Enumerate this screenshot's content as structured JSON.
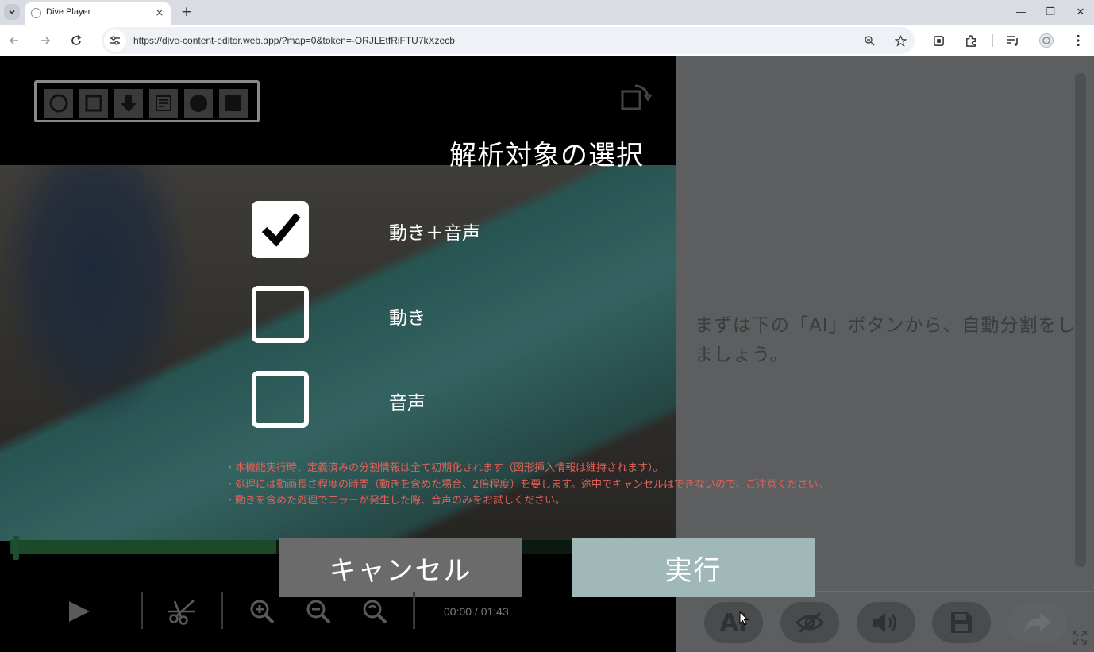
{
  "browser": {
    "tab_title": "Dive Player",
    "tab_close": "×",
    "new_tab": "+",
    "url": "https://dive-content-editor.web.app/?map=0&token=-ORJLEtfRiFTU7kXzecb",
    "window_controls": {
      "minimize": "—",
      "restore": "❐",
      "close": "✕"
    }
  },
  "editor": {
    "shape_tools": [
      "circle-outline",
      "square-outline",
      "arrow-down",
      "note",
      "circle-filled",
      "square-filled"
    ],
    "hint_text": "まずは下の「AI」ボタンから、自動分割をしましょう。",
    "time_display": "00:00 / 01:43",
    "progress_fraction": 0.4,
    "bottom_actions": [
      {
        "name": "ai-button",
        "label": "AI"
      },
      {
        "name": "hide-button",
        "label": ""
      },
      {
        "name": "volume-button",
        "label": ""
      },
      {
        "name": "save-button",
        "label": ""
      },
      {
        "name": "share-button",
        "label": ""
      }
    ]
  },
  "modal": {
    "title": "解析対象の選択",
    "options": [
      {
        "label": "動き＋音声",
        "checked": true
      },
      {
        "label": "動き",
        "checked": false
      },
      {
        "label": "音声",
        "checked": false
      }
    ],
    "notes": [
      "・本機能実行時、定義済みの分割情報は全て初期化されます（図形挿入情報は維持されます）。",
      "・処理には動画長さ程度の時間（動きを含めた場合、2倍程度）を要します。途中でキャンセルはできないので、ご注意ください。",
      "・動きを含めた処理でエラーが発生した際、音声のみをお試しください。"
    ],
    "cancel_label": "キャンセル",
    "run_label": "実行"
  }
}
